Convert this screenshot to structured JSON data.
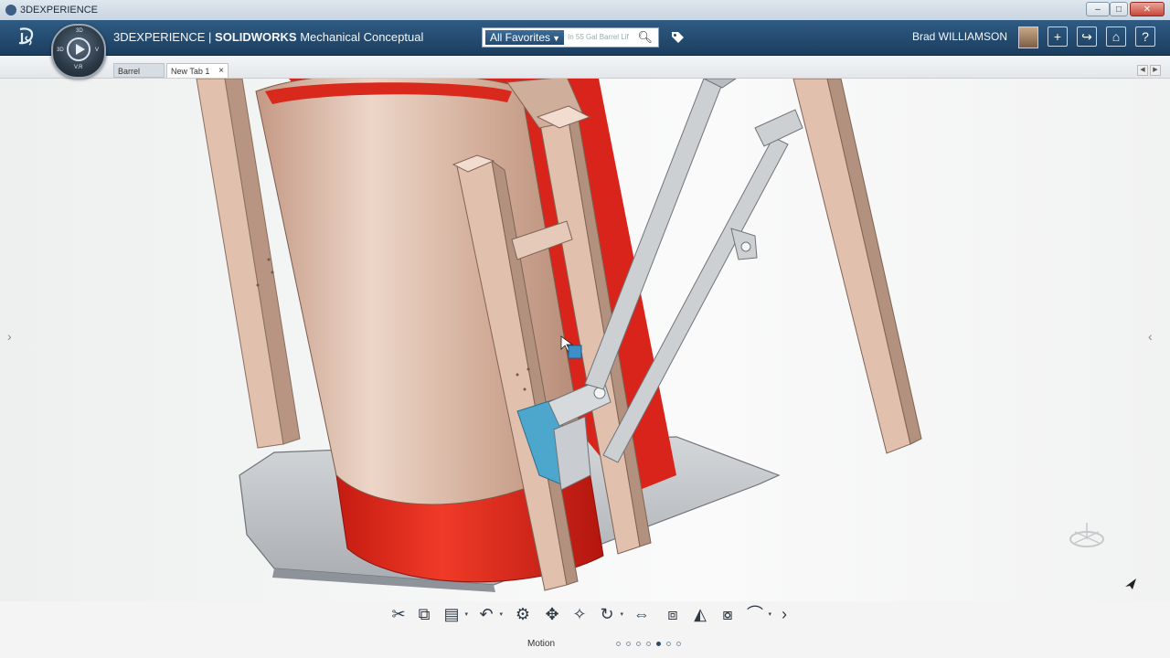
{
  "window": {
    "title": "3DEXPERIENCE",
    "minimize": "–",
    "maximize": "□",
    "close": "✕"
  },
  "appbar": {
    "logo": "3DS",
    "compass_labels": {
      "top": "3D",
      "left": "3D",
      "right": "V",
      "bottom": "V.R"
    },
    "app_prefix": "3DEXPERIENCE | ",
    "app_brand": "SOLIDWORKS",
    "app_suffix": " Mechanical Conceptual",
    "search": {
      "scope": "All Favorites",
      "placeholder": "In 55 Gal Barrel Lif"
    },
    "user": "Brad WILLIAMSON",
    "buttons": {
      "add": "+",
      "share": "↪",
      "home": "⌂",
      "help": "?"
    }
  },
  "tabs": [
    {
      "label": "Barrel Lifter",
      "active": false
    },
    {
      "label": "New Tab 1",
      "active": true,
      "close": "×"
    }
  ],
  "viewport": {
    "colors": {
      "barrel": "#d8b5a0",
      "barrel_ring": "#e8291c",
      "frame": "#e1c0ad",
      "plate": "#b8bcc0",
      "clamp": "#4da6cc"
    }
  },
  "toolbar": {
    "section": "Motion",
    "tools": [
      {
        "name": "cut-icon",
        "glyph": "✂",
        "menu": false
      },
      {
        "name": "copy-icon",
        "glyph": "⧉",
        "menu": false
      },
      {
        "name": "paste-icon",
        "glyph": "▤",
        "menu": true
      },
      {
        "name": "undo-icon",
        "glyph": "↶",
        "menu": true
      },
      {
        "name": "settings-gear-icon",
        "glyph": "⚙",
        "menu": false
      },
      {
        "name": "move-icon",
        "glyph": "✥",
        "menu": false
      },
      {
        "name": "rotate-icon",
        "glyph": "✧",
        "menu": false
      },
      {
        "name": "drag-icon",
        "glyph": "↻",
        "menu": true
      },
      {
        "name": "distance-icon",
        "glyph": "⇔",
        "menu": false
      },
      {
        "name": "mate-icon",
        "glyph": "⧈",
        "menu": false
      },
      {
        "name": "section-icon",
        "glyph": "◭",
        "menu": false
      },
      {
        "name": "interference-icon",
        "glyph": "⧇",
        "menu": false
      },
      {
        "name": "plot-icon",
        "glyph": "⌒",
        "menu": true
      },
      {
        "name": "more-icon",
        "glyph": "›",
        "menu": false
      }
    ],
    "section_dots": 7,
    "active_dot": 4
  }
}
